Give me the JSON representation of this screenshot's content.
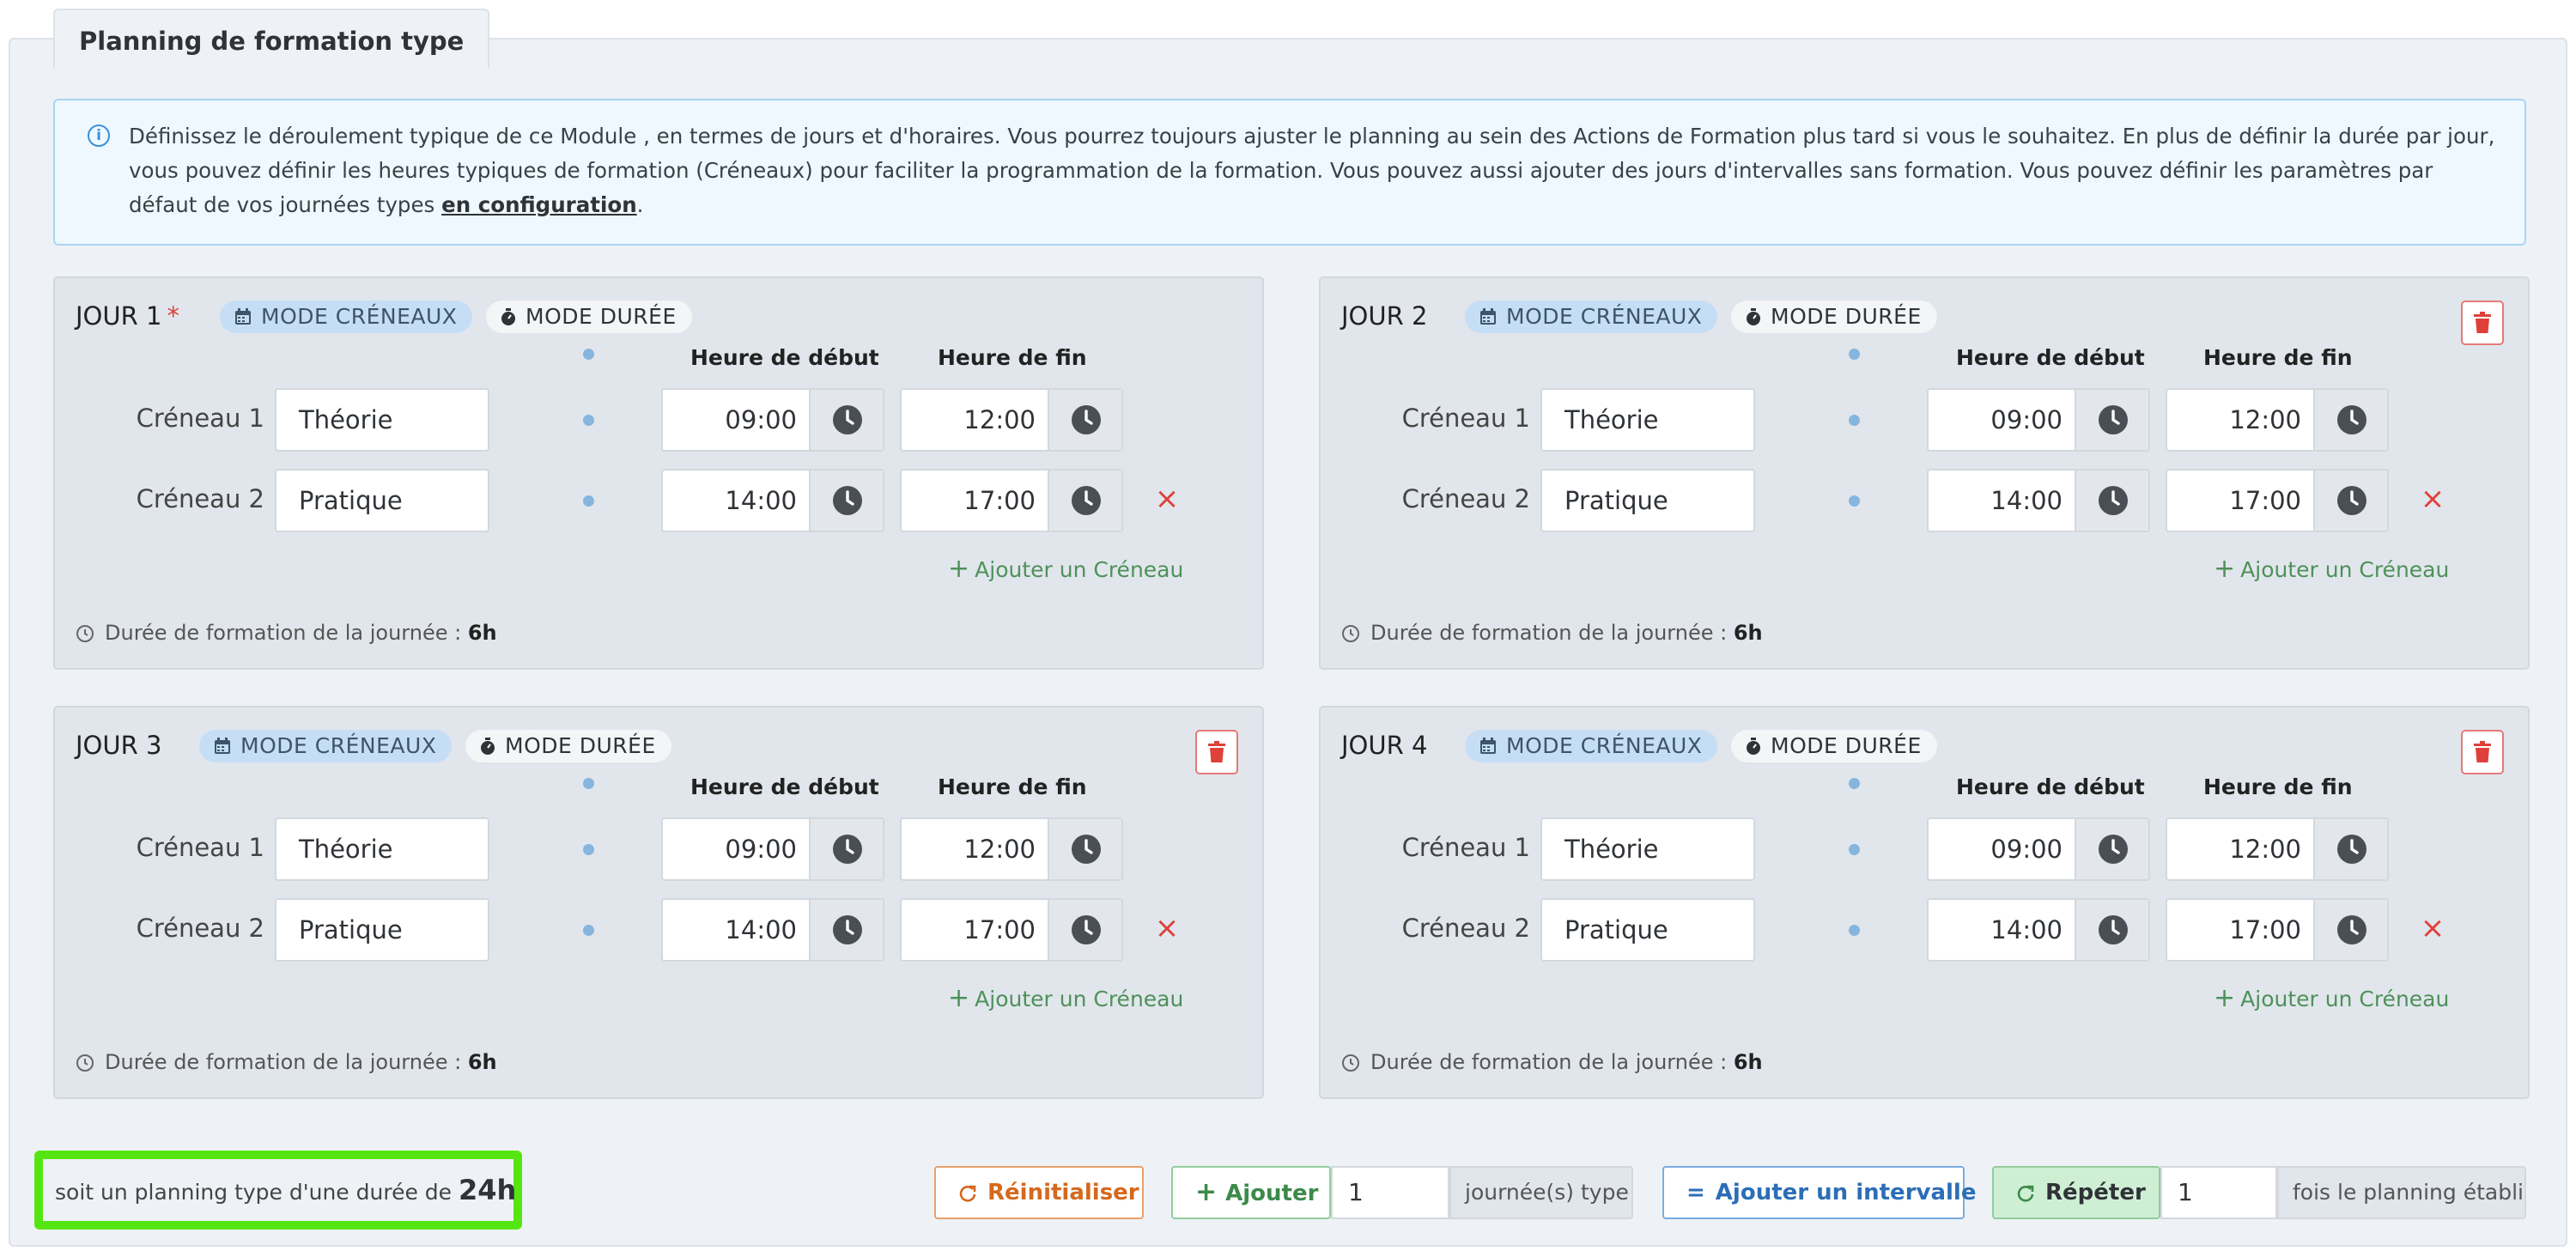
{
  "section": {
    "legend": "Planning de formation type",
    "info_text": "Définissez le déroulement typique de ce Module , en termes de jours et d'horaires. Vous pourrez toujours ajuster le planning au sein des Actions de Formation plus tard si vous le souhaitez. En plus de définir la durée par jour, vous pouvez définir les heures typiques de formation (Créneaux) pour faciliter la programmation de la formation. Vous pouvez aussi ajouter des jours d'intervalles sans formation. Vous pouvez définir les paramètres par défaut de vos journées types ",
    "info_link": "en configuration",
    "info_end": "."
  },
  "labels": {
    "mode_slots": "MODE CRÉNEAUX",
    "mode_duration": "MODE DURÉE",
    "start_header": "Heure de début",
    "end_header": "Heure de fin",
    "add_slot": "Ajouter un Créneau",
    "duration_prefix": "Durée de formation de la journée :",
    "required_mark": "*"
  },
  "days": [
    {
      "title": "JOUR 1",
      "required": true,
      "deletable": false,
      "duration": "6h",
      "slots": [
        {
          "label": "Créneau 1",
          "name": "Théorie",
          "start": "09:00",
          "end": "12:00",
          "removable": false
        },
        {
          "label": "Créneau 2",
          "name": "Pratique",
          "start": "14:00",
          "end": "17:00",
          "removable": true
        }
      ]
    },
    {
      "title": "JOUR 2",
      "required": false,
      "deletable": true,
      "duration": "6h",
      "slots": [
        {
          "label": "Créneau 1",
          "name": "Théorie",
          "start": "09:00",
          "end": "12:00",
          "removable": false
        },
        {
          "label": "Créneau 2",
          "name": "Pratique",
          "start": "14:00",
          "end": "17:00",
          "removable": true
        }
      ]
    },
    {
      "title": "JOUR 3",
      "required": false,
      "deletable": true,
      "duration": "6h",
      "slots": [
        {
          "label": "Créneau 1",
          "name": "Théorie",
          "start": "09:00",
          "end": "12:00",
          "removable": false
        },
        {
          "label": "Créneau 2",
          "name": "Pratique",
          "start": "14:00",
          "end": "17:00",
          "removable": true
        }
      ]
    },
    {
      "title": "JOUR 4",
      "required": false,
      "deletable": true,
      "duration": "6h",
      "slots": [
        {
          "label": "Créneau 1",
          "name": "Théorie",
          "start": "09:00",
          "end": "12:00",
          "removable": false
        },
        {
          "label": "Créneau 2",
          "name": "Pratique",
          "start": "14:00",
          "end": "17:00",
          "removable": true
        }
      ]
    }
  ],
  "footer": {
    "total_prefix": "soit un planning type d'une durée de",
    "total_value": "24h",
    "reset_label": "Réinitialiser",
    "add_label": "Ajouter",
    "add_count": "1",
    "add_suffix": "journée(s) type",
    "interval_label": "Ajouter un intervalle",
    "repeat_label": "Répéter",
    "repeat_count": "1",
    "repeat_suffix": "fois le planning établi"
  },
  "colors": {
    "highlight": "#55e612",
    "remove": "#e0403a",
    "add": "#4e9159"
  }
}
